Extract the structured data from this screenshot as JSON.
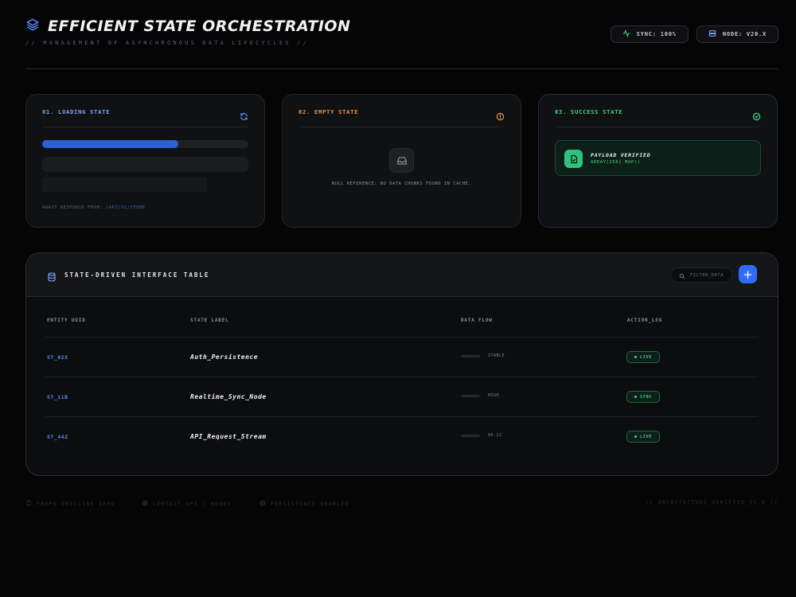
{
  "header": {
    "title": "EFFICIENT STATE ORCHESTRATION",
    "subtitle": "// MANAGEMENT OF ASYNCHRONOUS DATA LIFECYCLES //",
    "badges": [
      {
        "label": "SYNC: 100%",
        "icon": "activity-icon"
      },
      {
        "label": "NODE: V20.X",
        "icon": "server-icon"
      }
    ]
  },
  "cards": {
    "loading": {
      "title": "01. LOADING STATE",
      "title_color": "#7ea4ff",
      "progress": 0.66,
      "await_label": "AWAIT RESPONSE FROM:",
      "await_endpoint": "/API/V1/STORE"
    },
    "empty": {
      "title": "02. EMPTY STATE",
      "title_color": "#f0954a",
      "message": "NULL REFERENCE: NO DATA CHUNKS FOUND IN CACHE."
    },
    "success": {
      "title": "03. SUCCESS STATE",
      "title_color": "#3fd68a",
      "payload_title": "PAYLOAD VERIFIED",
      "payload_sub": "ARRAY[256] MAP()"
    }
  },
  "table": {
    "title": "STATE-DRIVEN INTERFACE TABLE",
    "filter_placeholder": "FILTER_DATA",
    "add_label": "+",
    "columns": [
      "ENTITY UUID",
      "STATE LABEL",
      "DATA FLOW",
      "ACTION_LOG"
    ],
    "rows": [
      {
        "uuid": "ST_02X",
        "label": "Auth_Persistence",
        "flow": 0.85,
        "flow_text": "STABLE",
        "action": "LIVE"
      },
      {
        "uuid": "ST_11B",
        "label": "Realtime_Sync_Node",
        "flow": 0.85,
        "flow_text": "HIGH",
        "action": "SYNC"
      },
      {
        "uuid": "ST_44Z",
        "label": "API_Request_Stream",
        "flow": 0.85,
        "flow_text": "80.22",
        "action": "LIVE"
      }
    ]
  },
  "footer": {
    "items": [
      "PROPS DRILLING ZERO",
      "CONTEXT API / HOOKS",
      "PERSISTENCE ENABLED"
    ],
    "right": "// ARCHITECTURE_VERIFIED_V1.0 //"
  }
}
